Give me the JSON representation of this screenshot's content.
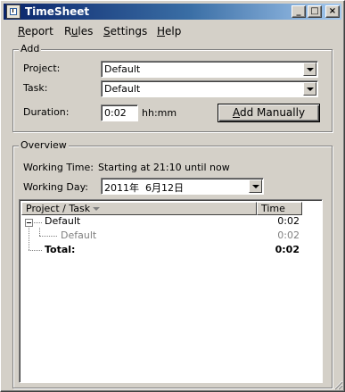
{
  "window": {
    "title": "TimeSheet",
    "controls": {
      "minimize": "_",
      "maximize": "□",
      "close": "×"
    }
  },
  "menu": [
    {
      "label": "Report",
      "mnemonic": "R"
    },
    {
      "label": "Rules",
      "mnemonic": "u"
    },
    {
      "label": "Settings",
      "mnemonic": "S"
    },
    {
      "label": "Help",
      "mnemonic": "H"
    }
  ],
  "add": {
    "group_label": "Add",
    "project_label": "Project:",
    "project_value": "Default",
    "task_label": "Task:",
    "task_value": "Default",
    "duration_label": "Duration:",
    "duration_value": "0:02",
    "duration_unit": "hh:mm",
    "add_button": "Add Manually"
  },
  "overview": {
    "group_label": "Overview",
    "working_time_label": "Working Time:",
    "working_time_value": "Starting at 21:10 until now",
    "working_day_label": "Working Day:",
    "working_day_value": "2011年  6月12日",
    "columns": [
      "Project / Task",
      "Time"
    ],
    "rows": [
      {
        "name": "Default",
        "time": "0:02",
        "level": 0
      },
      {
        "name": "Default",
        "time": "0:02",
        "level": 1
      },
      {
        "name": "Total:",
        "time": "0:02",
        "level": 0,
        "bold": true
      }
    ]
  }
}
